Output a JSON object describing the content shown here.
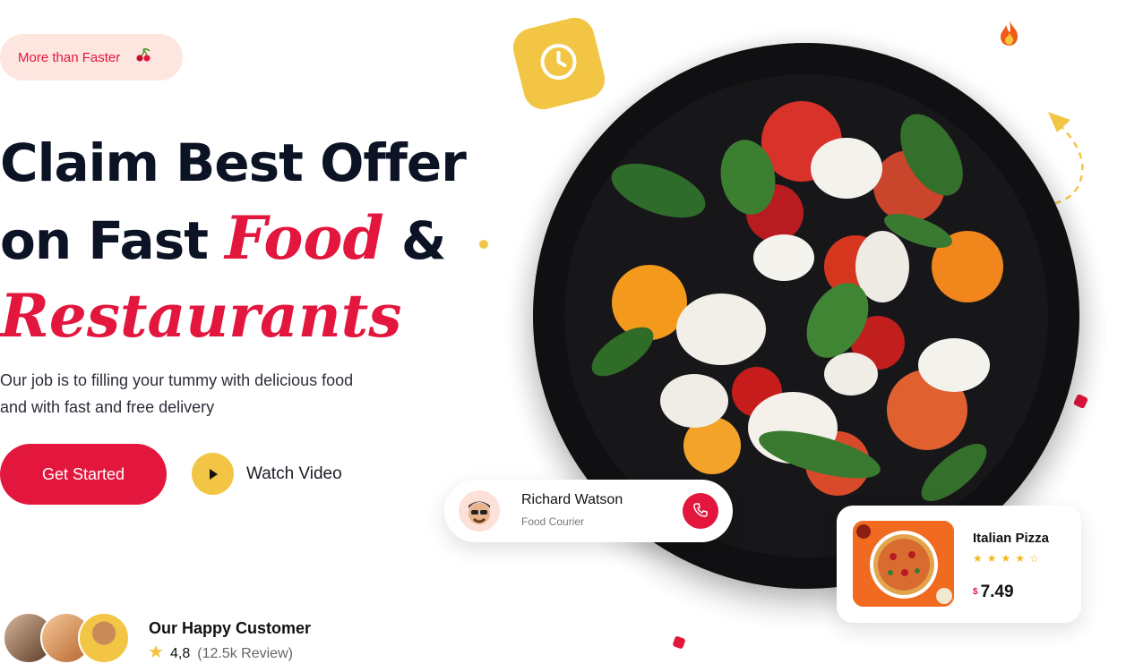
{
  "hero": {
    "badge": "More than Faster",
    "headline_line1": "Claim Best Offer",
    "headline_line2_prefix": "on Fast",
    "headline_highlight_food": "Food",
    "headline_ampersand": "&",
    "headline_highlight_restaurants": "Restaurants",
    "subtext_line1": "Our job is to filling your tummy with delicious food",
    "subtext_line2": "and  with fast and free delivery",
    "cta_primary": "Get Started",
    "cta_secondary": "Watch Video"
  },
  "customers": {
    "title": "Our Happy Customer",
    "rating": "4,8",
    "reviews": "(12.5k Review)"
  },
  "courier": {
    "name": "Richard Watson",
    "role": "Food Courier"
  },
  "product": {
    "name": "Italian Pizza",
    "currency": "$",
    "price": "7.49",
    "rating": 4
  },
  "icons": {
    "badge": "cherry-icon",
    "cta_secondary": "play-icon",
    "rating": "star-icon",
    "clock": "clock-icon",
    "call": "phone-icon",
    "decoration": "fire-icon"
  },
  "colors": {
    "accent_red": "#e3163d",
    "accent_yellow": "#f3c544",
    "text_dark": "#0b1324",
    "badge_bg": "#fde6df"
  }
}
